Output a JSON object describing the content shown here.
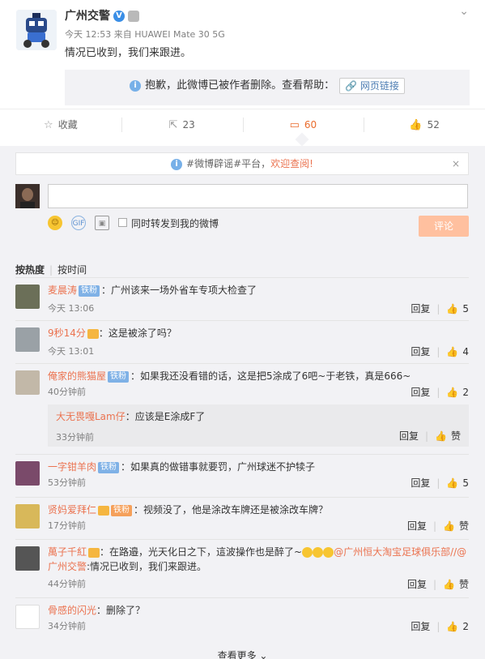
{
  "post": {
    "author": "广州交警",
    "verified_mark": "V",
    "meta": "今天 12:53 来自 HUAWEI Mate 30 5G",
    "text": "情况已收到，我们来跟进。",
    "chevron": "⌄",
    "deleted_notice": "抱歉，此微博已被作者删除。查看帮助：",
    "help_link": "网页链接",
    "actions": {
      "favorite": "收藏",
      "repost": "23",
      "comment": "60",
      "like": "52"
    }
  },
  "notice": {
    "prefix": "#微博辟谣#平台，",
    "highlight": "欢迎查阅!",
    "close": "×"
  },
  "composer": {
    "repost_label": "同时转发到我的微博",
    "submit": "评论"
  },
  "sort": {
    "hot": "按热度",
    "time": "按时间"
  },
  "comments": [
    {
      "nick": "麦晨涛",
      "tag": "铁粉",
      "text": "：广州该来一场外省车专项大检查了",
      "time": "今天 13:06",
      "reply": "回复",
      "likes": "5"
    },
    {
      "nick": "9秒14分",
      "text": "：这是被涂了吗？",
      "time": "今天 13:01",
      "reply": "回复",
      "likes": "4"
    },
    {
      "nick": "俺家的熊猫屋",
      "tag": "铁粉",
      "text": "：如果我还没看错的话，这是把5涂成了6吧~于老铁，真是666~",
      "time": "40分钟前",
      "reply": "回复",
      "likes": "2"
    },
    {
      "nick": "一字钳羊肉",
      "tag": "铁粉",
      "text": "：如果真的做错事就要罚，广州球迷不护犊子",
      "time": "53分钟前",
      "reply": "回复",
      "likes": "5"
    },
    {
      "nick": "贤妈爱拜仁",
      "tag": "铁粉",
      "text": "：视频没了，他是涂改车牌还是被涂改车牌？",
      "time": "17分钟前",
      "reply": "回复",
      "likes": "赞"
    },
    {
      "nick": "萬子千紅",
      "text": "：在路邉，光天化日之下，這波操作也是醉了~",
      "mention1": "@广州恒大淘宝足球俱乐部",
      "mention2": "//@广州交警",
      "text2": ":情况已收到，我们来跟进。",
      "time": "44分钟前",
      "reply": "回复",
      "likes": "赞"
    },
    {
      "nick": "骨感的闪光",
      "text": "：删除了？",
      "time": "34分钟前",
      "reply": "回复",
      "likes": "2"
    }
  ],
  "sub_reply": {
    "nick": "大无畏嘎Lam仔",
    "text": "：应该是E涂成F了",
    "time": "33分钟前",
    "reply": "回复",
    "likes": "赞"
  },
  "more": "查看更多 ⌄"
}
